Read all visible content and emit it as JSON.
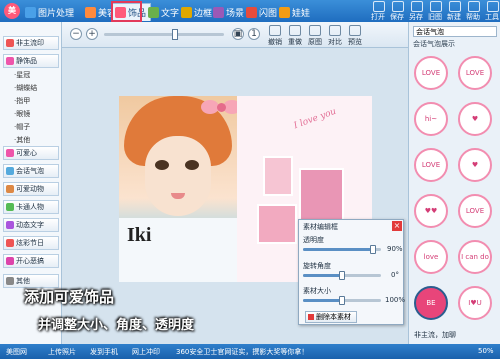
{
  "app": {
    "logo_text": "美"
  },
  "tabs": [
    {
      "label": "图片处理",
      "color": "#4aa0e8"
    },
    {
      "label": "美容",
      "color": "#ff8a3d"
    },
    {
      "label": "饰品",
      "color": "#ff5a7a"
    },
    {
      "label": "文字",
      "color": "#6ab04c"
    },
    {
      "label": "边框",
      "color": "#e0a800"
    },
    {
      "label": "场景",
      "color": "#9b59b6"
    },
    {
      "label": "闪图",
      "color": "#e74c3c"
    },
    {
      "label": "娃娃",
      "color": "#f39c12"
    }
  ],
  "top_tools": [
    "打开",
    "保存",
    "另存",
    "旧图",
    "新建",
    "帮助",
    "工具"
  ],
  "left_panel": {
    "items": [
      {
        "label": "非主流印",
        "color": "#e55"
      },
      {
        "label": "静饰品",
        "color": "#e5a"
      },
      {
        "label": "可爱心",
        "color": "#e5a"
      },
      {
        "label": "会话气泡",
        "color": "#5ad"
      },
      {
        "label": "可爱动物",
        "color": "#d84"
      },
      {
        "label": "卡通人物",
        "color": "#5b5"
      },
      {
        "label": "动态文字",
        "color": "#a5d"
      },
      {
        "label": "炫彩节日",
        "color": "#e55"
      },
      {
        "label": "开心恶搞",
        "color": "#d4a"
      },
      {
        "label": "其他",
        "color": "#888"
      }
    ],
    "sub_items": [
      "·星冠",
      "·蝴蝶结",
      "·指甲",
      "·眼镜",
      "·帽子",
      "·其他"
    ]
  },
  "toolbar": {
    "buttons": [
      "撤销",
      "重做",
      "原图",
      "对比",
      "预览"
    ]
  },
  "right_panel": {
    "search_value": "会话气泡",
    "header": "会话气泡展示",
    "stickers": [
      "LOVE",
      "LOVE",
      "hi~",
      "♥",
      "LOVE",
      "♥",
      "♥♥",
      "LOVE",
      "love",
      "I can do it",
      "BE HAPPY",
      "I♥U"
    ],
    "footer": "非主流，加聊"
  },
  "photo": {
    "label": "Iki",
    "script_text": "I love you"
  },
  "dialog": {
    "title": "素材编辑框",
    "opacity_label": "透明度",
    "opacity_value": "90%",
    "opacity": 0.9,
    "rotate_label": "旋转角度",
    "rotate_value": "0°",
    "rotate_fraction": 0.5,
    "size_label": "素材大小",
    "size_value": "100%",
    "size_fraction": 0.5,
    "delete_label": "删除本素材"
  },
  "caption": {
    "line1": "添加可爱饰品",
    "line2": "并调整大小、角度、透明度"
  },
  "status": {
    "items": [
      "美图网",
      "上传照片",
      "发到手机",
      "网上冲印"
    ],
    "center": "360安全卫士官网证实，撰影大奖等你拿！",
    "right": "50%"
  }
}
